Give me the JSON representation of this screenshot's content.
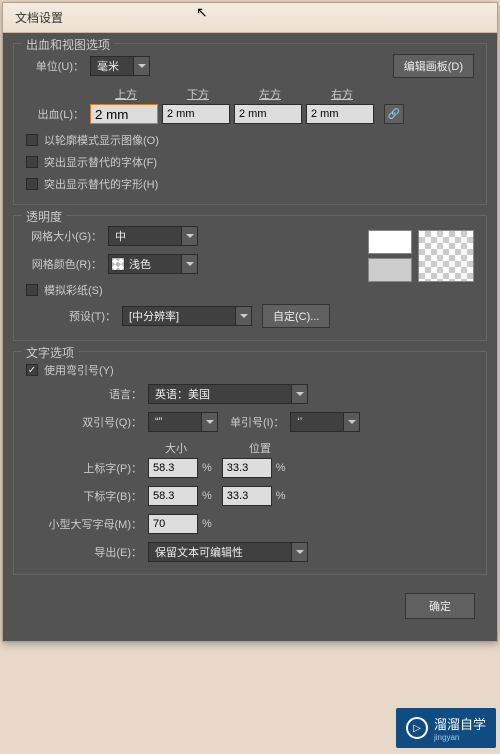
{
  "window": {
    "title": "文档设置"
  },
  "bleed": {
    "group_title": "出血和视图选项",
    "unit_label": "单位(U)：",
    "unit_value": "毫米",
    "edit_artboards": "编辑画板(D)",
    "bleed_label": "出血(L)：",
    "top": "上方",
    "bottom": "下方",
    "left": "左方",
    "right": "右方",
    "top_v": "2 mm",
    "bottom_v": "2 mm",
    "left_v": "2 mm",
    "right_v": "2 mm",
    "cb_outline": "以轮廓模式显示图像(O)",
    "cb_highlight_font": "突出显示替代的字体(F)",
    "cb_highlight_glyph": "突出显示替代的字形(H)"
  },
  "transparency": {
    "group_title": "透明度",
    "grid_size_label": "网格大小(G)：",
    "grid_size_value": "中",
    "grid_color_label": "网格颜色(R)：",
    "grid_color_value": "浅色",
    "cb_simulate": "模拟彩纸(S)",
    "preset_label": "预设(T)：",
    "preset_value": "[中分辨率]",
    "custom_btn": "自定(C)..."
  },
  "text": {
    "group_title": "文字选项",
    "cb_quotes": "使用弯引号(Y)",
    "lang_label": "语言：",
    "lang_value": "英语：美国",
    "dq_label": "双引号(Q)：",
    "dq_value": "“”",
    "sq_label": "单引号(I)：",
    "sq_value": "‘’",
    "size_header": "大小",
    "pos_header": "位置",
    "sup_label": "上标字(P)：",
    "sup_size": "58.3",
    "sup_pos": "33.3",
    "sub_label": "下标字(B)：",
    "sub_size": "58.3",
    "sub_pos": "33.3",
    "smallcap_label": "小型大写字母(M)：",
    "smallcap_v": "70",
    "export_label": "导出(E)：",
    "export_value": "保留文本可编辑性",
    "percent": "%"
  },
  "footer": {
    "ok": "确定"
  },
  "watermark": {
    "brand": "溜溜自学",
    "sub": "jingyan"
  }
}
